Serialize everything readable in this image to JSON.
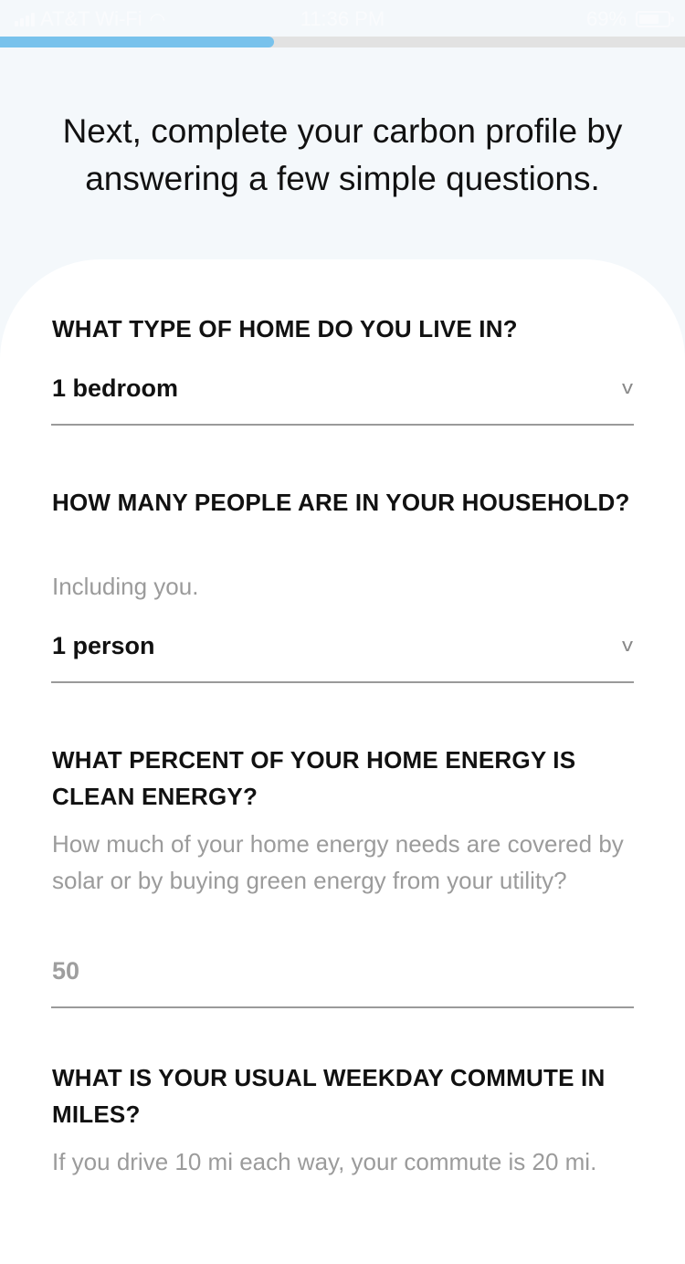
{
  "status_bar": {
    "carrier": "AT&T Wi-Fi",
    "time": "11:36 PM",
    "battery": "69%"
  },
  "progress": {
    "fraction": 0.4
  },
  "intro": {
    "text": "Next, complete your carbon profile by answering a few simple questions."
  },
  "questions": [
    {
      "title": "WHAT TYPE OF HOME DO YOU LIVE IN?",
      "value": "1 bedroom"
    },
    {
      "title": "HOW MANY PEOPLE ARE IN YOUR HOUSEHOLD?",
      "helper": "Including you.",
      "value": "1 person"
    },
    {
      "title": "WHAT PERCENT OF YOUR HOME ENERGY IS CLEAN ENERGY?",
      "helper": "How much of your home energy needs are covered by solar or by buying green energy from your utility?",
      "placeholder": "50"
    },
    {
      "title": "WHAT IS YOUR USUAL WEEKDAY COMMUTE IN MILES?",
      "helper": "If you drive 10 mi each way, your commute is 20 mi."
    }
  ],
  "icons": {
    "chevron": "chevron-down-icon",
    "wifi": "wifi-icon",
    "battery": "battery-icon",
    "signal": "signal-icon"
  },
  "colors": {
    "progress_fill": "#78c2ec",
    "progress_track": "#e2e2e2",
    "background": "#f4f8fb",
    "card": "#ffffff",
    "helper_text": "#9b9b9b"
  }
}
